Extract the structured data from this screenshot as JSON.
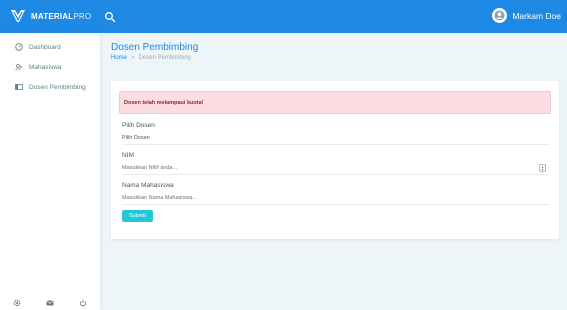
{
  "app": {
    "logo_text": "MATERIAL",
    "logo_suffix": "PRO"
  },
  "header": {
    "user_name": "Markam Doe"
  },
  "sidebar": {
    "items": [
      {
        "label": "Dashboard",
        "icon": "dashboard-icon"
      },
      {
        "label": "Mahasiswa",
        "icon": "users-icon"
      },
      {
        "label": "Dosen Pembimbing",
        "icon": "table-icon"
      }
    ],
    "footer_icons": [
      "settings-icon",
      "mail-icon",
      "power-icon"
    ]
  },
  "page": {
    "title": "Dosen Pembimbing",
    "breadcrumb": {
      "home": "Home",
      "separator": ">",
      "current": "Dosen Pembimbing"
    }
  },
  "form": {
    "alert": "Dosen telah melampaui kuota!",
    "pilih_dosen": {
      "label": "Pilih Dosen",
      "value": "Pilih Dosen"
    },
    "nim": {
      "label": "NIM",
      "placeholder": "Masukkan NIM anda..."
    },
    "nama": {
      "label": "Nama Mahasiswa",
      "placeholder": "Masukkan Nama Mahasiswa..."
    },
    "submit_label": "Submit"
  },
  "colors": {
    "primary": "#1e88e5",
    "submit": "#26c6da",
    "alert_bg": "#fcdde3",
    "alert_text": "#a0212f"
  }
}
